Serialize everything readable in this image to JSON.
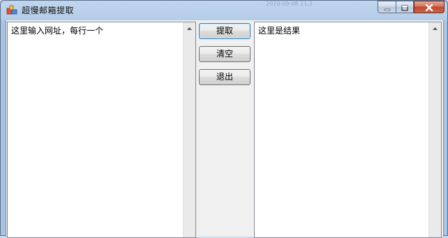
{
  "window": {
    "title": "超慢邮箱提取",
    "background_faint_text": "2020-09-08  21:2"
  },
  "caption_buttons": {
    "minimize_icon": "minimize-icon",
    "maximize_icon": "maximize-icon",
    "close_icon": "close-icon"
  },
  "input_panel": {
    "text": "这里输入网址，每行一个"
  },
  "output_panel": {
    "text": "这里是结果"
  },
  "buttons": {
    "extract": "提取",
    "clear": "清空",
    "exit": "退出"
  },
  "colors": {
    "titlebar": "#b6cde8",
    "close_button": "#c0472d",
    "client_background": "#f0f0f0",
    "default_button_border": "#3c7fb1"
  }
}
